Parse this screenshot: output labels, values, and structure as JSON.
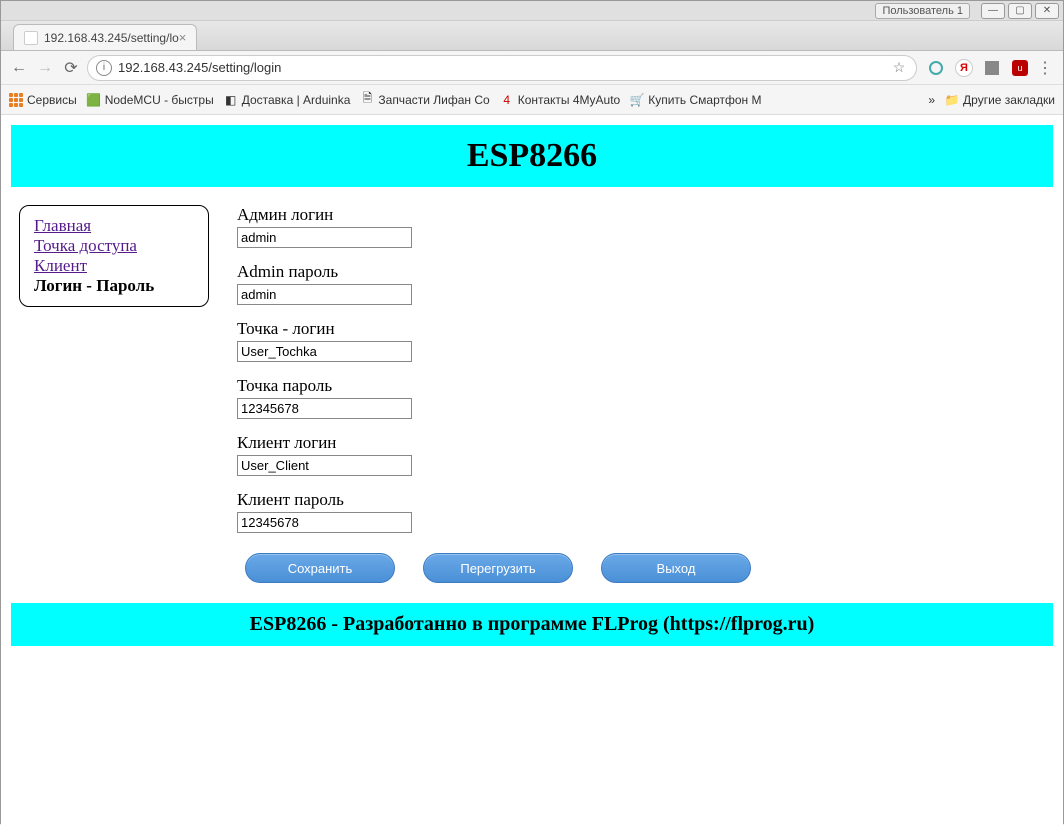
{
  "window": {
    "user_badge": "Пользователь 1"
  },
  "browser": {
    "tab_title": "192.168.43.245/setting/lo",
    "url": "192.168.43.245/setting/login"
  },
  "bookmarks": {
    "services": "Сервисы",
    "items": [
      "NodeMCU - быстры",
      "Доставка | Arduinka",
      "Запчасти Лифан Со",
      "Контакты 4MyAuto",
      "Купить Смартфон M"
    ],
    "other": "Другие закладки"
  },
  "page": {
    "title": "ESP8266",
    "footer": "ESP8266 - Разработанно в программе FLProg (https://flprog.ru)"
  },
  "menu": {
    "home": "Главная",
    "ap": "Точка доступа",
    "client": "Клиент",
    "login": "Логин - Пароль"
  },
  "form": {
    "admin_login_label": "Админ логин",
    "admin_login_value": "admin",
    "admin_pass_label": "Admin пароль",
    "admin_pass_value": "admin",
    "ap_login_label": "Точка - логин",
    "ap_login_value": "User_Tochka",
    "ap_pass_label": "Точка пароль",
    "ap_pass_value": "12345678",
    "client_login_label": "Клиент логин",
    "client_login_value": "User_Client",
    "client_pass_label": "Клиент пароль",
    "client_pass_value": "12345678"
  },
  "buttons": {
    "save": "Сохранить",
    "reload": "Перегрузить",
    "exit": "Выход"
  }
}
